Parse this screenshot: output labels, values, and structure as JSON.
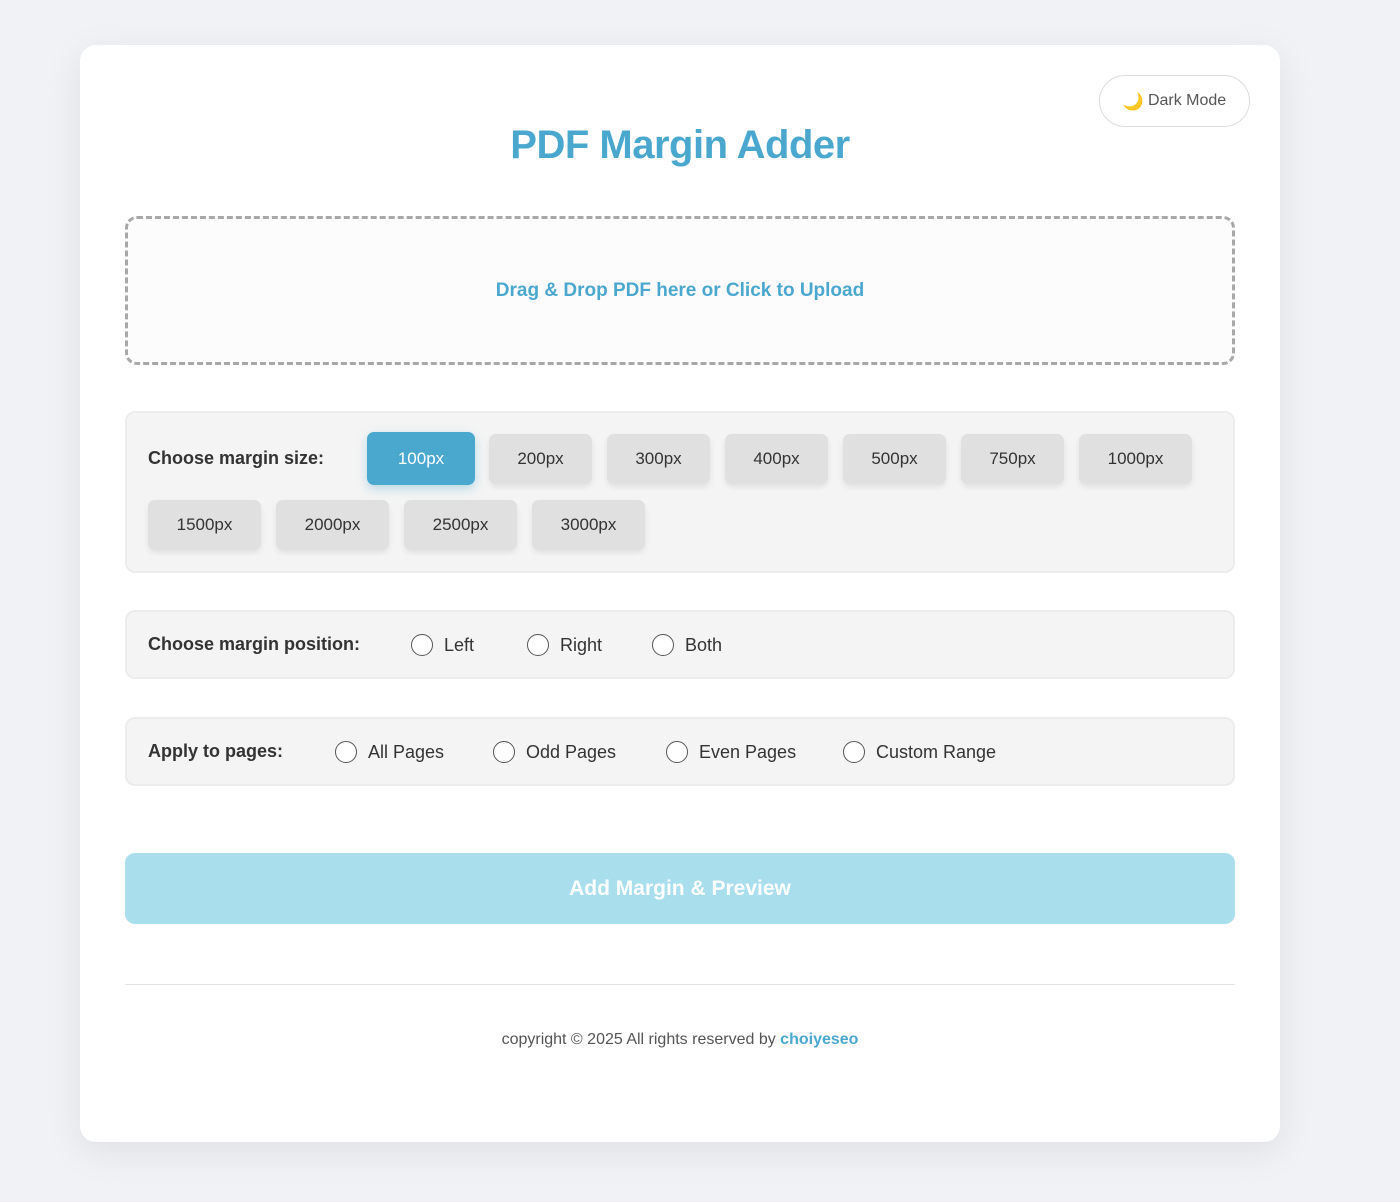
{
  "header": {
    "dark_mode_icon": "moon-icon",
    "dark_mode_glyph": "🌙",
    "dark_mode_label": "Dark Mode",
    "title": "PDF Margin Adder"
  },
  "upload": {
    "label": "Drag & Drop PDF here or Click to Upload"
  },
  "margin_size": {
    "label": "Choose margin size:",
    "selected": "100px",
    "options": [
      "100px",
      "200px",
      "300px",
      "400px",
      "500px",
      "750px",
      "1000px",
      "1500px",
      "2000px",
      "2500px",
      "3000px"
    ]
  },
  "margin_position": {
    "label": "Choose margin position:",
    "options": [
      "Left",
      "Right",
      "Both"
    ]
  },
  "apply_pages": {
    "label": "Apply to pages:",
    "options": [
      "All Pages",
      "Odd Pages",
      "Even Pages",
      "Custom Range"
    ]
  },
  "submit": {
    "label": "Add Margin & Preview"
  },
  "footer": {
    "text": "copyright © 2025 All rights reserved by",
    "link": "choiyeseo"
  },
  "colors": {
    "accent": "#4aa8cf",
    "submit_disabled": "#a9deed",
    "background": "#f0f2f5"
  }
}
